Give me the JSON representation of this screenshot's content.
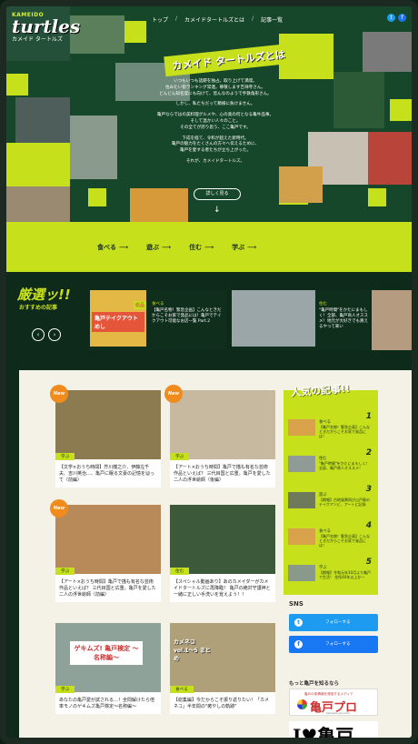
{
  "header": {
    "logo_small": "KAMEIDO",
    "logo_big": "turtles",
    "logo_sub": "カメイド タートルズ",
    "nav": [
      "トップ",
      "カメイドタートルズとは",
      "記事一覧"
    ],
    "nav_sep": "/",
    "social": [
      {
        "icon": "twitter-icon",
        "glyph": "t",
        "color": "#1d9bf0"
      },
      {
        "icon": "facebook-icon",
        "glyph": "f",
        "color": "#1877f2"
      }
    ],
    "banner_title": "カメイド タートルズとは",
    "hero_paragraphs": [
      "いつもいつも話題を独占。取り上げて満席。",
      "住みたい街ランキング常連。尊敬します吉祥寺さん。",
      "どんどん知名度にも向けて、皆んなのようで手鉄角形さん。",
      "しかし、私たちだって頼様に負けません。",
      "亀戸ならではの美料理グルメや、心の奥の何となる亀牛品事。",
      "そして温かい人々のこと。",
      "その全てが誇り思う、ここ亀戸です。",
      "下成を経て、令和が超えた新時代。",
      "亀戸の魅力をたくさんの方々へ伝えるために、",
      "亀戸を愛する者たちが立ち上がった。",
      "それが、カメイドタートルズ。"
    ],
    "more_button": "詳しく見る",
    "down_arrow": "↓"
  },
  "categories": [
    {
      "label": "食べる",
      "arrow": "⟶"
    },
    {
      "label": "遊ぶ",
      "arrow": "⟶"
    },
    {
      "label": "住む",
      "arrow": "⟶"
    },
    {
      "label": "学ぶ",
      "arrow": "⟶"
    }
  ],
  "picks": {
    "title": "厳選ッ!!",
    "subtitle": "おすすめの記事",
    "prev": "‹",
    "next": "›",
    "cards": [
      {
        "image_caption": "亀戸テイクアウトめし",
        "badge": "総品",
        "tag": "食べる",
        "text": "【亀戸名物！緊急企画】こんなときだからこそお家で発品には！亀戸でテイクアウト可能なお店一覧 Part.2"
      },
      {
        "image_caption": "",
        "badge": "",
        "tag": "住む",
        "text": "\"亀戸時間\"をかたにまもしく！全部、亀戸商人オススメ！地元が大好きでも買えるやって来い"
      }
    ]
  },
  "articles": [
    {
      "new": true,
      "tag": "学ぶ",
      "text": "【文学×おうち時間】芥川龍之介、伊藤左千夫、吉川英治…、亀戸に眠る文豪の記憶を辿って（前編）"
    },
    {
      "new": true,
      "tag": "学ぶ",
      "text": "【アート×おうち時間】亀戸で描も有名な芸術作品といえば？ 三代目国と広重。亀戸を愛した二人の浮世絵師（後編）"
    },
    {
      "new": true,
      "tag": "学ぶ",
      "text": "【アート×おうち時間】亀戸で描も有名な芸術作品といえば？ 三代目国と広重。亀戸を愛した二人の浮世絵師（前編）"
    },
    {
      "new": false,
      "tag": "住む",
      "text": "【スペシャル動画あり】あのカメイダーがカメイドタートルズに再降臨！ 亀戸の絶対守護神と一緒に正しい手洗いを覚えよう！！"
    },
    {
      "new": false,
      "tag": "学ぶ",
      "text": "あなたの亀戸愛が試される…！全問解けたら倍率モノのゲキムズ亀戸検定〜名称編〜",
      "image_caption": "ゲキムズ! 亀戸検定 〜名称編〜"
    },
    {
      "new": false,
      "tag": "食べる",
      "text": "【総集編】今だからこそ振り返りたい！「カメネコ」半年間の\"癒やしの軌跡\"",
      "image_caption": "カメネコ vol.1〜5 まとめ"
    }
  ],
  "popular": {
    "title": "人気の記事!!",
    "items": [
      {
        "num": "1",
        "cat": "食べる",
        "text": "【亀戸名物！緊急企画】こんなときだからこそお家で発品には！"
      },
      {
        "num": "2",
        "cat": "住む",
        "text": "\"亀戸時間\"をかたにまもしく！全部、亀戸商人オススメ！"
      },
      {
        "num": "3",
        "cat": "遊ぶ",
        "text": "【朗報】古地風景再び山戸駅のテイクアンビ、アートに記録"
      },
      {
        "num": "4",
        "cat": "食べる",
        "text": "【亀戸名物！緊急企画】こんなときだからこそお家で発品には！"
      },
      {
        "num": "5",
        "cat": "学ぶ",
        "text": "【朗報】令和元年10月より亀戸で生活！ 住所40年以上か一"
      }
    ]
  },
  "sns": {
    "title": "SNS",
    "twitter_label": "フォローする",
    "facebook_label": "フォローする"
  },
  "more": {
    "title": "もっと亀戸を知るなら",
    "ad1_small": "亀戸の街情報を発信するメディア",
    "ad1_big": "亀戸プロ",
    "ad1_domain": "kameido-pro.com",
    "ad2_text": "I♥亀戸"
  }
}
